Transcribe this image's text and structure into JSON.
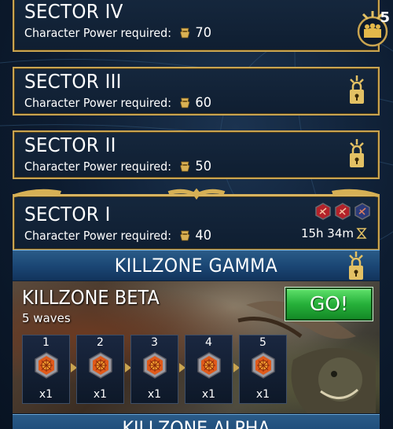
{
  "sectors": [
    {
      "name": "SECTOR IV",
      "req_label": "Character Power required:",
      "power": "70"
    },
    {
      "name": "SECTOR III",
      "req_label": "Character Power required:",
      "power": "60"
    },
    {
      "name": "SECTOR II",
      "req_label": "Character Power required:",
      "power": "50"
    },
    {
      "name": "SECTOR I",
      "req_label": "Character Power required:",
      "power": "40"
    }
  ],
  "squad_badge": {
    "count": "5",
    "icon": "squad-icon"
  },
  "sector1": {
    "timer": "15h 34m",
    "gem_icons": [
      "red-gem-icon",
      "red-gem-icon",
      "blue-gem-icon"
    ]
  },
  "killzones": {
    "gamma": {
      "title": "KILLZONE GAMMA"
    },
    "beta": {
      "title": "KILLZONE BETA",
      "waves_label": "5 waves",
      "go_label": "GO!",
      "waves": [
        {
          "num": "1",
          "qty": "x1"
        },
        {
          "num": "2",
          "qty": "x1"
        },
        {
          "num": "3",
          "qty": "x1"
        },
        {
          "num": "4",
          "qty": "x1"
        },
        {
          "num": "5",
          "qty": "x1"
        }
      ]
    },
    "alpha": {
      "title": "KILLZONE ALPHA"
    }
  },
  "colors": {
    "gold": "#c9a450",
    "go_green": "#26b03a",
    "banner_blue": "#1b4775"
  }
}
